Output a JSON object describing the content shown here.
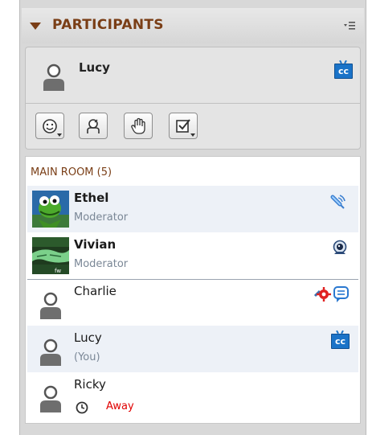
{
  "panel": {
    "title": "PARTICIPANTS",
    "menu_icon": "panel-options-icon"
  },
  "current_user": {
    "name": "Lucy",
    "status_icon": "closed-caption-icon",
    "cc_text": "cc"
  },
  "toolbar": {
    "buttons": [
      {
        "name": "set-status-button",
        "icon": "smiley-icon",
        "has_dropdown": true
      },
      {
        "name": "away-button",
        "icon": "step-away-icon",
        "has_dropdown": false
      },
      {
        "name": "raise-hand-button",
        "icon": "hand-icon",
        "has_dropdown": false
      },
      {
        "name": "feedback-button",
        "icon": "checkbox-icon",
        "has_dropdown": true
      }
    ]
  },
  "room": {
    "label": "MAIN ROOM (5)",
    "participants": [
      {
        "name": "Ethel",
        "role": "Moderator",
        "bold": true,
        "avatar": "photo-frog",
        "status_icon": "microphone-icon"
      },
      {
        "name": "Vivian",
        "role": "Moderator",
        "bold": true,
        "avatar": "photo-lizard",
        "status_icon": "webcam-icon"
      },
      {
        "name": "Charlie",
        "role": "",
        "bold": false,
        "avatar": "default-avatar",
        "status_icon": "settings-chat-icons"
      },
      {
        "name": "Lucy",
        "role": "(You)",
        "bold": false,
        "avatar": "default-avatar",
        "status_icon": "closed-caption-icon"
      },
      {
        "name": "Ricky",
        "role": "",
        "bold": false,
        "avatar": "default-avatar",
        "status_icon": "clock-icon",
        "status_text": "Away"
      }
    ]
  },
  "colors": {
    "title": "#7a3e16",
    "role_text": "#7a8796",
    "away_text": "#e00000",
    "cc_blue": "#1a73c8",
    "alt_row": "#edf1f7"
  }
}
